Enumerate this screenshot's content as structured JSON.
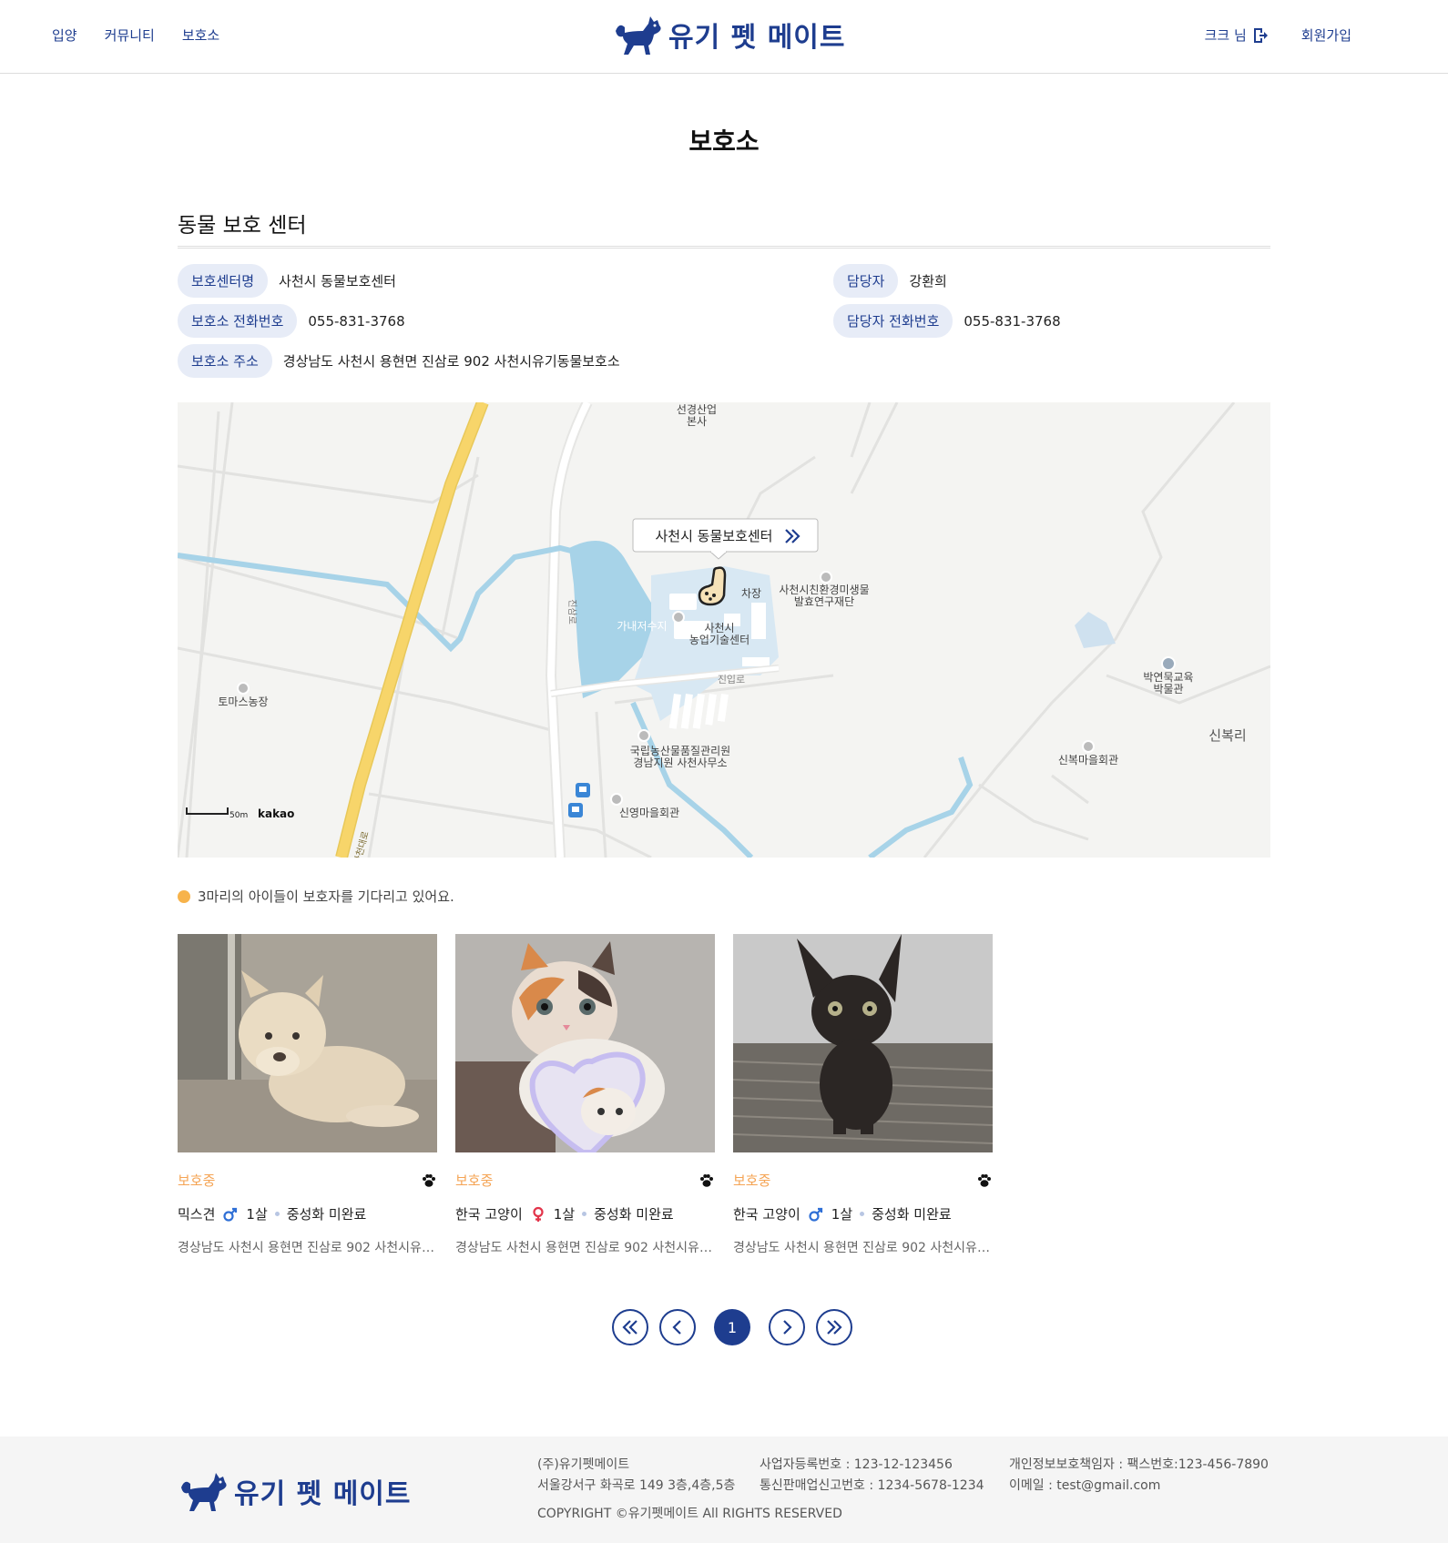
{
  "header": {
    "nav": [
      "입양",
      "커뮤니티",
      "보호소"
    ],
    "logo_text": "유기 펫 메이트",
    "user_name": "크크 님",
    "signup": "회원가입"
  },
  "page_title": "보호소",
  "center": {
    "section_title": "동물 보호 센터",
    "name_label": "보호센터명",
    "name": "사천시 동물보호센터",
    "phone_label": "보호소 전화번호",
    "phone": "055-831-3768",
    "address_label": "보호소 주소",
    "address": "경상남도 사천시 용현면 진삼로 902 사천시유기동물보호소",
    "manager_label": "담당자",
    "manager": "강환희",
    "manager_phone_label": "담당자 전화번호",
    "manager_phone": "055-831-3768"
  },
  "map": {
    "marker_label": "사천시 동물보호센터",
    "labels": {
      "sungyeong": "선경산업\n본사",
      "gane": "가내저수지",
      "agri": "사천시\n농업기술센터",
      "eco": "사천시친환경미생물\n발효연구재단",
      "parking": "차장",
      "jinip": "진입로",
      "tomas": "토마스농장",
      "naqs": "국립농산물품질관리원\n경남지원 사천사무소",
      "sinyoung": "신영마을회관",
      "sinbok_hall": "신복마을회관",
      "sinbokri": "신복리",
      "museum": "박연묵교육\n박물관",
      "jinsamro": "진삼로",
      "sacheondaero": "사천대로"
    },
    "scale": "50m",
    "brand": "kakao"
  },
  "waiting_text": "3마리의 아이들이 보호자를 기다리고 있어요.",
  "animals": [
    {
      "status": "보호중",
      "breed": "믹스견",
      "gender": "male",
      "age": "1살",
      "neuter": "중성화 미완료",
      "address": "경상남도 사천시 용현면 진삼로 902 사천시유기동물보호소"
    },
    {
      "status": "보호중",
      "breed": "한국 고양이",
      "gender": "female",
      "age": "1살",
      "neuter": "중성화 미완료",
      "address": "경상남도 사천시 용현면 진삼로 902 사천시유기동물보호소"
    },
    {
      "status": "보호중",
      "breed": "한국 고양이",
      "gender": "male",
      "age": "1살",
      "neuter": "중성화 미완료",
      "address": "경상남도 사천시 용현면 진삼로 902 사천시유기동물보호소"
    }
  ],
  "pagination": {
    "current": "1"
  },
  "footer": {
    "logo_text": "유기 펫 메이트",
    "company": "(주)유기펫메이트",
    "address": "서울강서구 화곡로 149 3층,4층,5층",
    "biz_no": "사업자등록번호 : 123-12-123456",
    "mail_order": "통신판매업신고번호 : 1234-5678-1234",
    "privacy": "개인정보보호책임자 : 팩스번호:123-456-7890",
    "email": "이메일 : test@gmail.com",
    "copyright": "COPYRIGHT ©유기펫메이트 All RIGHTS RESERVED"
  },
  "colors": {
    "brand": "#1e3d8f",
    "status": "#f5a454",
    "pill_bg": "#e7ecf7",
    "water": "#a7d3e8",
    "road": "#f7d56a",
    "male": "#2f6fd6",
    "female": "#e2344a"
  }
}
